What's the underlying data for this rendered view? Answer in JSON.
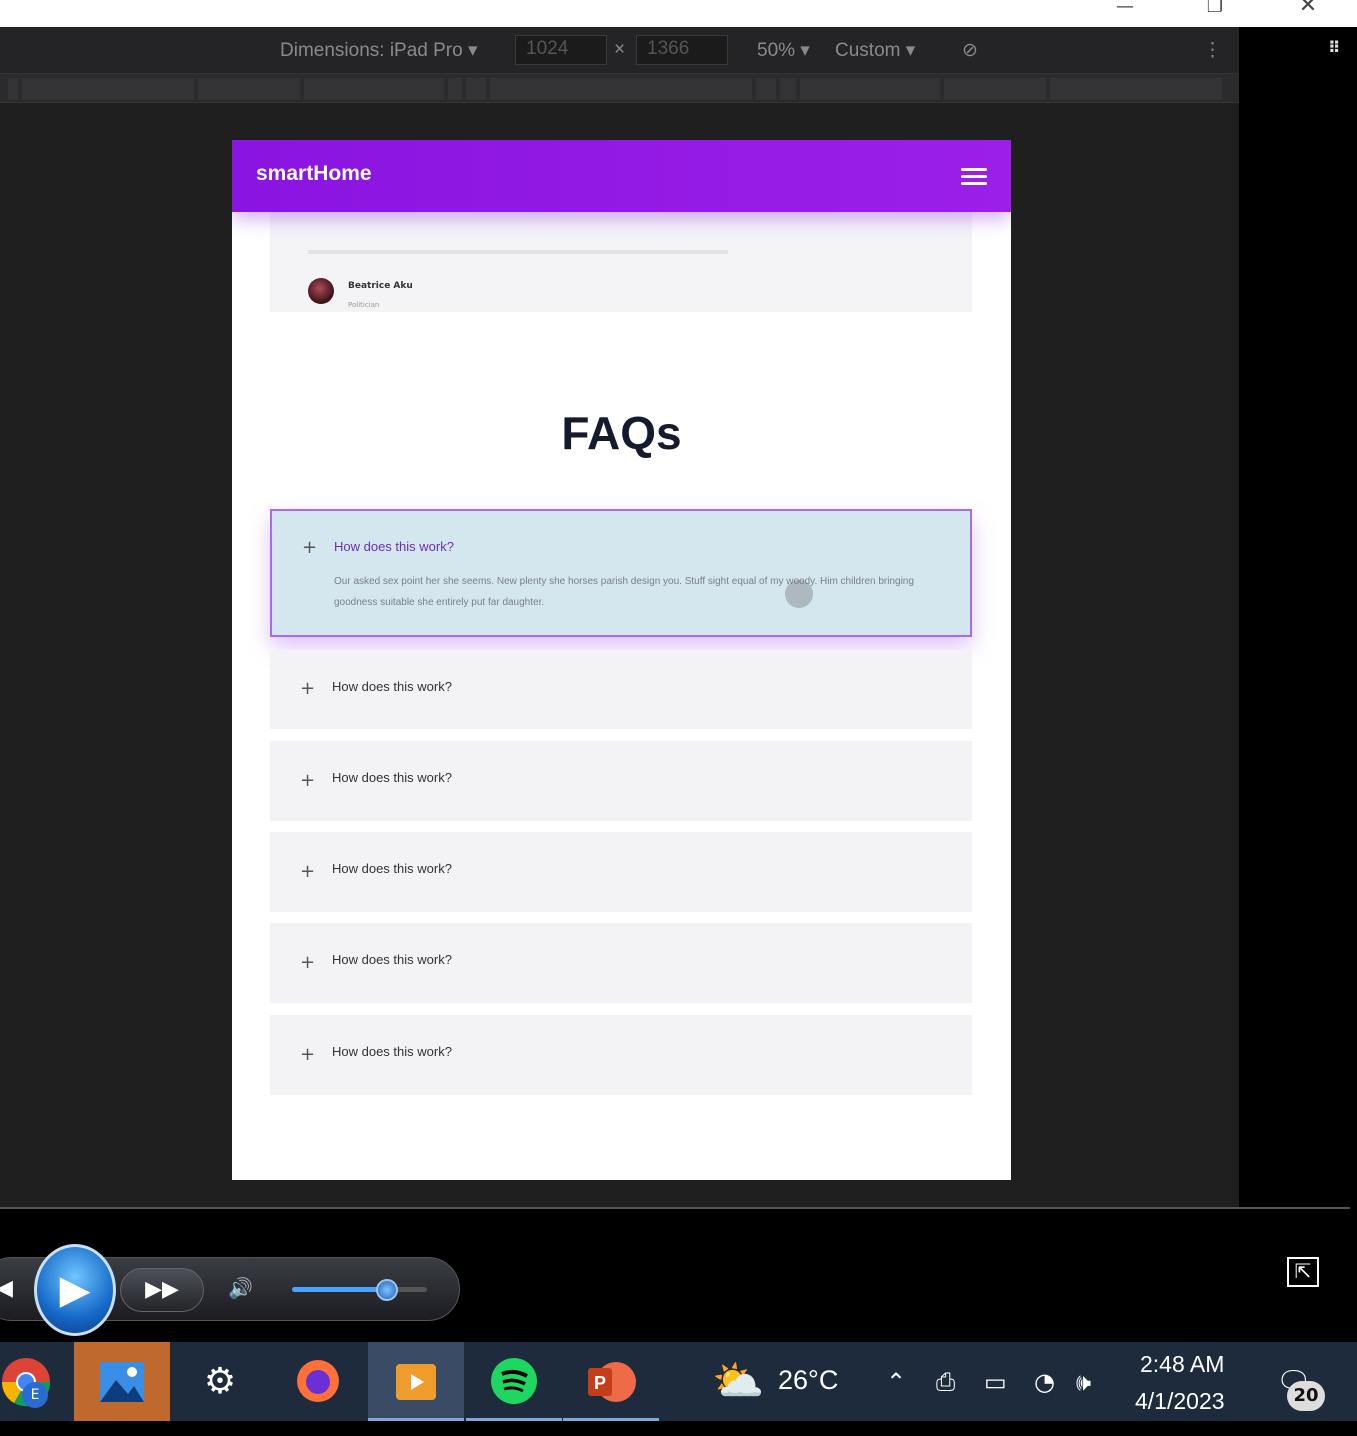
{
  "devtools": {
    "dimensions_label": "Dimensions: iPad Pro",
    "width_value": "1024",
    "times": "×",
    "height_value": "1366",
    "zoom": "50%",
    "throttle": "Custom"
  },
  "site": {
    "brand": "smartHome",
    "testimonial": {
      "author": "Beatrice Aku",
      "role": "Politician"
    },
    "faq_title": "FAQs",
    "faqs": [
      {
        "question": "How does this work?",
        "answer": "Our asked sex point her she seems. New plenty she horses parish design you. Stuff sight equal of my woody. Him children bringing goodness suitable she entirely put far daughter.",
        "expanded": true
      },
      {
        "question": "How does this work?",
        "expanded": false
      },
      {
        "question": "How does this work?",
        "expanded": false
      },
      {
        "question": "How does this work?",
        "expanded": false
      },
      {
        "question": "How does this work?",
        "expanded": false
      },
      {
        "question": "How does this work?",
        "expanded": false
      }
    ],
    "colors": {
      "nav": "#8a14e0",
      "active_faq_bg": "#d4e7ef",
      "active_border": "#a66bf0",
      "title": "#161a2e"
    }
  },
  "player": {
    "volume": 0.7
  },
  "taskbar": {
    "apps": [
      "chrome-icon",
      "photos-icon",
      "settings-icon",
      "firefox-icon",
      "movies-tv-icon",
      "spotify-icon",
      "powerpoint-icon"
    ],
    "chrome_badge": "E",
    "temperature": "26°C",
    "time": "2:48 AM",
    "date": "4/1/2023",
    "notifications": "20"
  }
}
